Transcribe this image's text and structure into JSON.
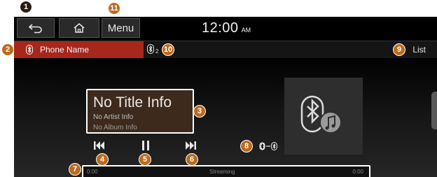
{
  "topbar": {
    "menu_label": "Menu",
    "clock_time": "12:00",
    "clock_ampm": "AM"
  },
  "sourcebar": {
    "device_name": "Phone Name",
    "list_label": "List"
  },
  "track": {
    "title": "No Title Info",
    "artist": "No Artist Info",
    "album": "No Album Info"
  },
  "progress": {
    "elapsed": "0:00",
    "status": "Streaming",
    "total": "0:00"
  },
  "callouts": {
    "back": "1",
    "phone_tab": "2",
    "info": "3",
    "prev": "4",
    "pause": "5",
    "next": "6",
    "progress": "7",
    "bt_mode": "8",
    "list": "9",
    "bt_device": "10",
    "menu": "11"
  },
  "icons": {
    "back": "back-arrow-icon",
    "home": "home-icon",
    "bluetooth": "bluetooth-icon",
    "bluetooth_audio": "bluetooth-audio-icon",
    "prev": "skip-previous-icon",
    "pause": "pause-icon",
    "next": "skip-next-icon"
  },
  "colors": {
    "source_tab": "#a7271c",
    "callout": "#bc6b1c",
    "info_box": "#3d2a1c"
  }
}
